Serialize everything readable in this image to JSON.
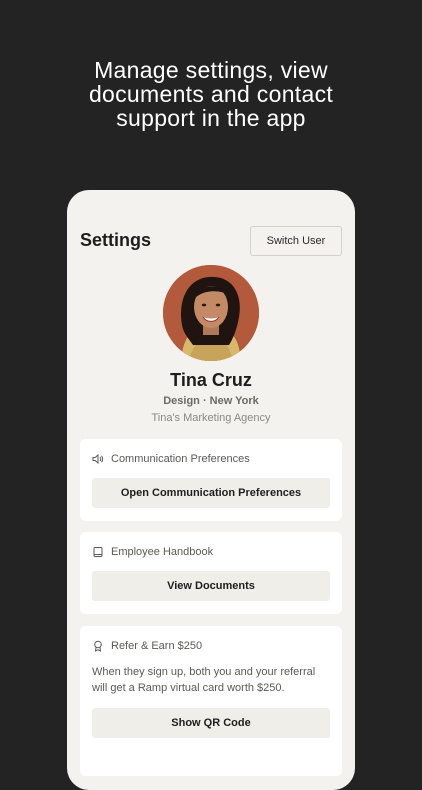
{
  "headline": {
    "line1": "Manage settings, view",
    "line2": "documents and contact",
    "line3": "support in the app"
  },
  "screen": {
    "title": "Settings",
    "switch_user_label": "Switch User"
  },
  "profile": {
    "name": "Tina Cruz",
    "meta": "Design · New York",
    "company": "Tina's Marketing Agency"
  },
  "cards": {
    "communication": {
      "title": "Communication Preferences",
      "icon": "speaker-icon",
      "button": "Open Communication Preferences"
    },
    "handbook": {
      "title": "Employee Handbook",
      "icon": "book-icon",
      "button": "View Documents"
    },
    "refer": {
      "title": "Refer & Earn $250",
      "icon": "badge-icon",
      "text": "When they sign up, both you and your referral will get a Ramp virtual card worth $250.",
      "button": "Show QR Code"
    }
  },
  "colors": {
    "background": "#232323",
    "screen": "#f3f2ee",
    "card": "#ffffff",
    "button": "#efeee9",
    "avatar_bg": "#b35a3c"
  }
}
